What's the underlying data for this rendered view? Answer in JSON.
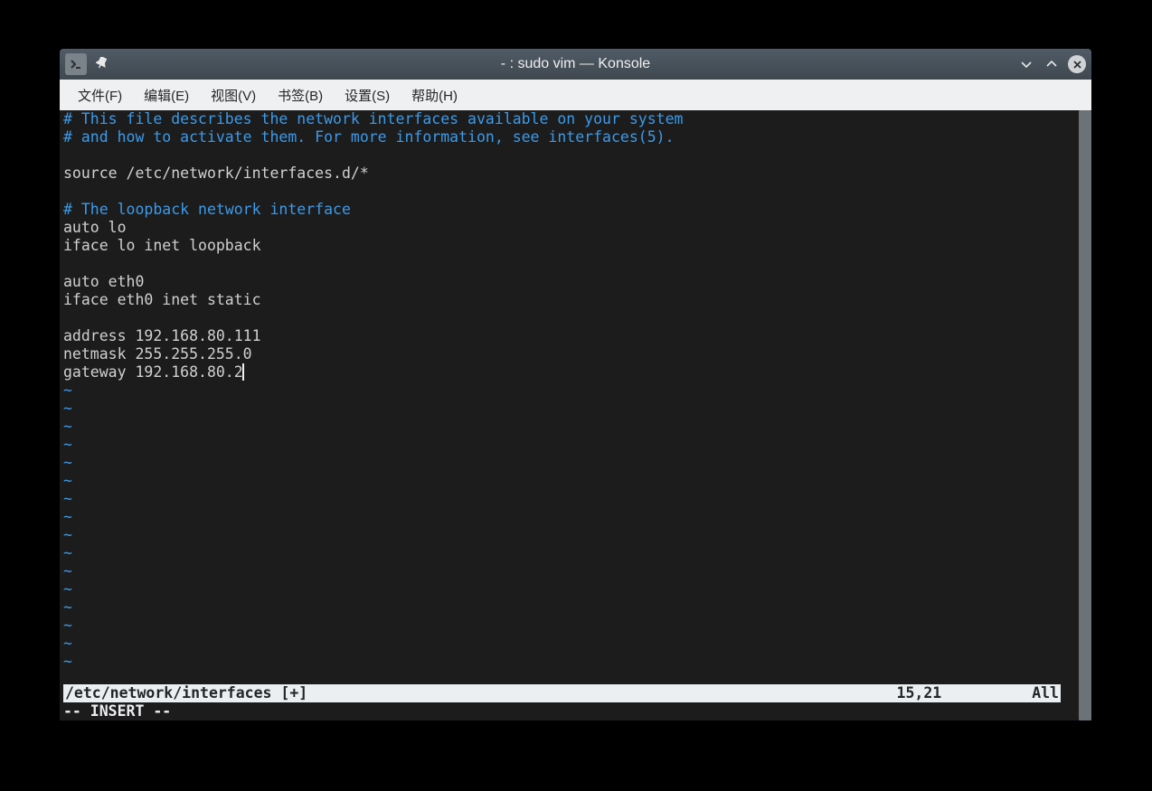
{
  "window": {
    "title": "- : sudo vim — Konsole"
  },
  "menubar": {
    "items": [
      "文件(F)",
      "编辑(E)",
      "视图(V)",
      "书签(B)",
      "设置(S)",
      "帮助(H)"
    ]
  },
  "editor": {
    "lines": [
      {
        "t": "# This file describes the network interfaces available on your system",
        "c": true
      },
      {
        "t": "# and how to activate them. For more information, see interfaces(5).",
        "c": true
      },
      {
        "t": "",
        "c": false
      },
      {
        "t": "source /etc/network/interfaces.d/*",
        "c": false
      },
      {
        "t": "",
        "c": false
      },
      {
        "t": "# The loopback network interface",
        "c": true
      },
      {
        "t": "auto lo",
        "c": false
      },
      {
        "t": "iface lo inet loopback",
        "c": false
      },
      {
        "t": "",
        "c": false
      },
      {
        "t": "auto eth0",
        "c": false
      },
      {
        "t": "iface eth0 inet static",
        "c": false
      },
      {
        "t": "",
        "c": false
      },
      {
        "t": "address 192.168.80.111",
        "c": false
      },
      {
        "t": "netmask 255.255.255.0",
        "c": false
      },
      {
        "t": "gateway 192.168.80.2",
        "c": false,
        "cursor": true
      }
    ],
    "tilde": "~",
    "tilde_count": 16,
    "status_file": "/etc/network/interfaces [+]",
    "status_pos": "15,21",
    "status_all": "All",
    "mode": "-- INSERT --"
  }
}
